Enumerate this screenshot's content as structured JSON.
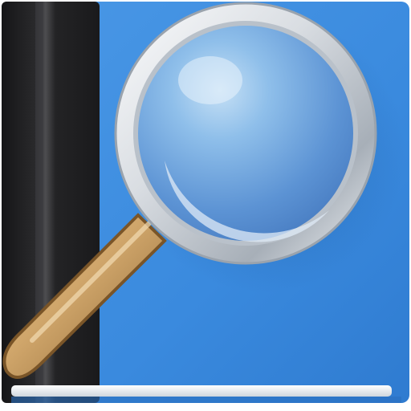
{
  "icon": {
    "name": "book-search-icon",
    "colors": {
      "book_blue": "#3c8ede",
      "book_blue_dark": "#2a6fc0",
      "spine_black": "#1d1d1f",
      "spine_highlight": "#4a4a4c",
      "lens_blue": "#7fb3e3",
      "lens_blue_dark": "#4f86c9",
      "ring_silver": "#e3e6ea",
      "ring_shadow": "#8f98a3",
      "handle_tan": "#cfa56a",
      "handle_dark": "#9a733f",
      "page_edge": "#f4f6f8"
    }
  }
}
